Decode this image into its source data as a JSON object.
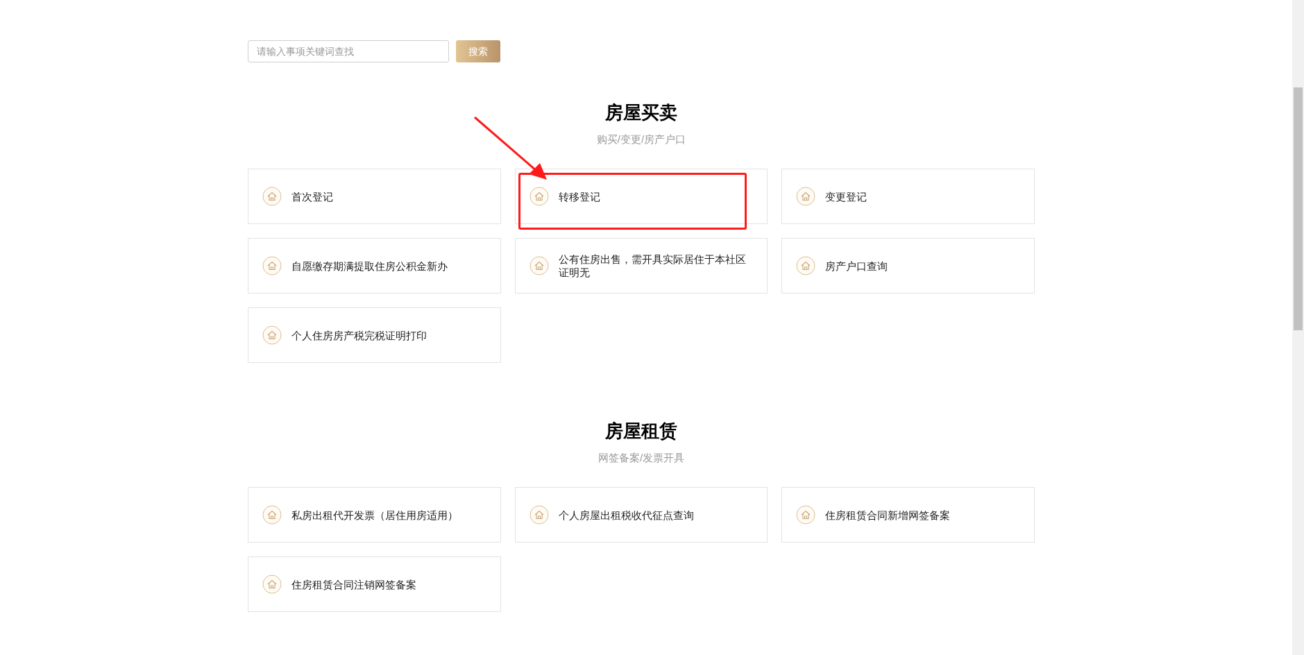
{
  "search": {
    "placeholder": "请输入事项关键词查找",
    "button": "搜索"
  },
  "sections": [
    {
      "title": "房屋买卖",
      "subtitle": "购买/变更/房产户口",
      "items": [
        {
          "label": "首次登记",
          "highlighted": false
        },
        {
          "label": "转移登记",
          "highlighted": true
        },
        {
          "label": "变更登记",
          "highlighted": false
        },
        {
          "label": "自愿缴存期满提取住房公积金新办",
          "highlighted": false
        },
        {
          "label": "公有住房出售，需开具实际居住于本社区证明无",
          "highlighted": false
        },
        {
          "label": "房产户口查询",
          "highlighted": false
        },
        {
          "label": "个人住房房产税完税证明打印",
          "highlighted": false
        }
      ]
    },
    {
      "title": "房屋租赁",
      "subtitle": "网签备案/发票开具",
      "items": [
        {
          "label": "私房出租代开发票（居住用房适用）",
          "highlighted": false
        },
        {
          "label": "个人房屋出租税收代征点查询",
          "highlighted": false
        },
        {
          "label": "住房租赁合同新增网签备案",
          "highlighted": false
        },
        {
          "label": "住房租赁合同注销网签备案",
          "highlighted": false
        }
      ]
    }
  ]
}
